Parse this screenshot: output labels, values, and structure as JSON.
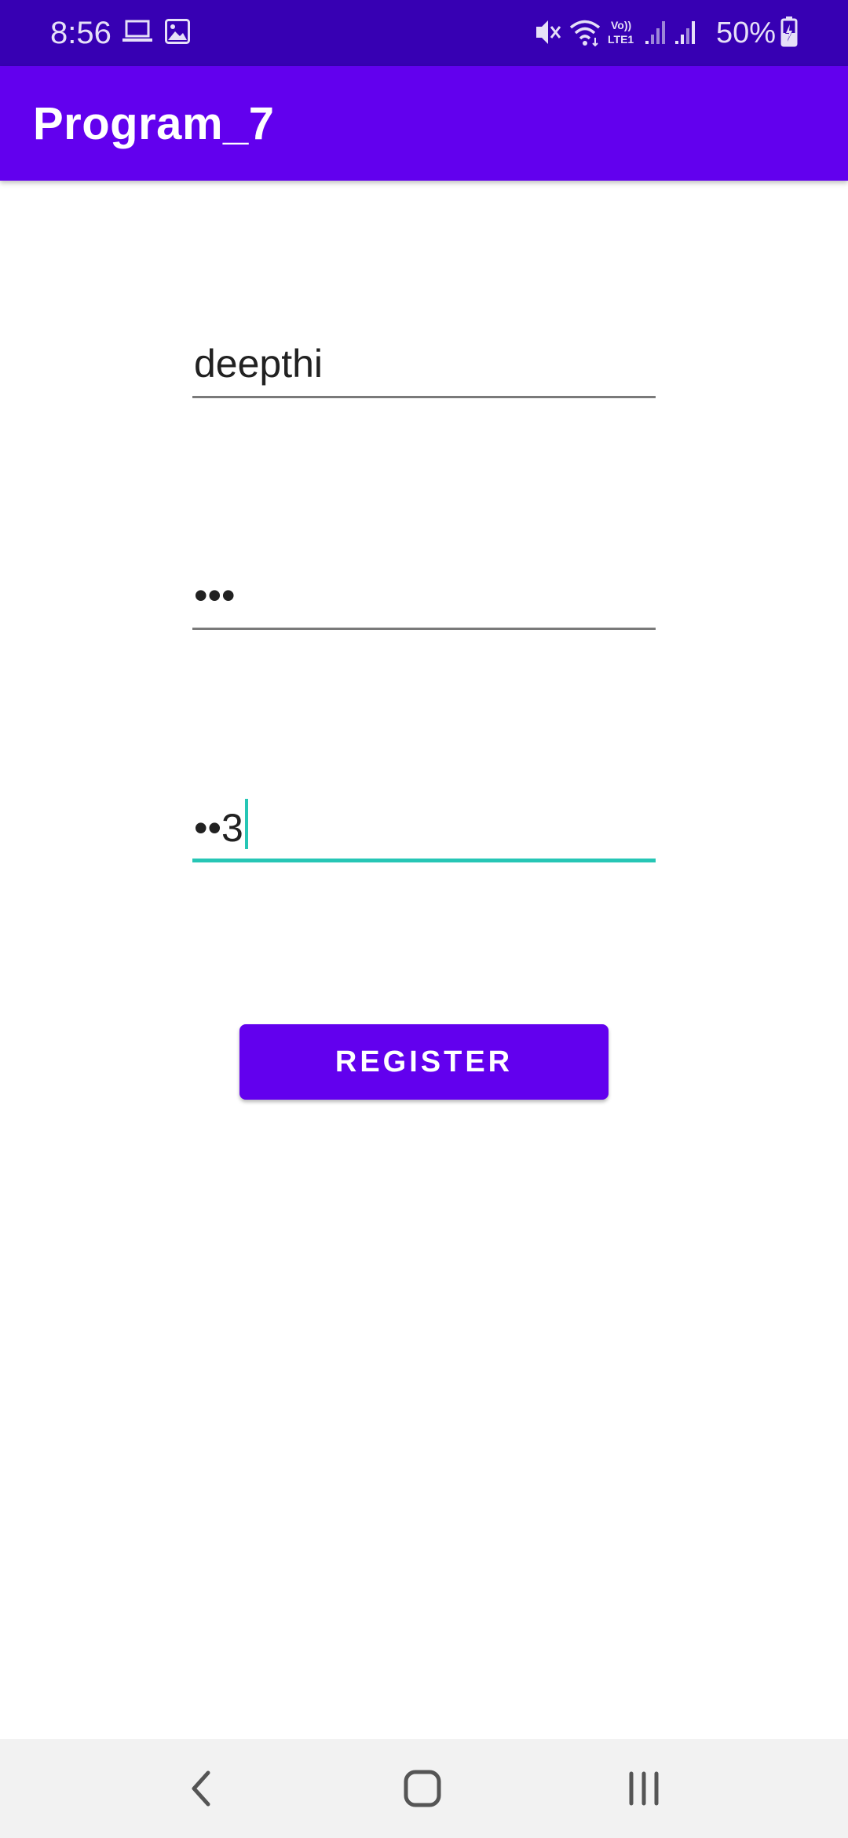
{
  "status_bar": {
    "time": "8:56",
    "battery_percent": "50%",
    "icons": [
      "laptop-icon",
      "image-icon",
      "mute-icon",
      "wifi-icon",
      "volte-icon",
      "signal-icon",
      "signal-icon",
      "battery-charging-icon"
    ],
    "volte_label": "Vo)) LTE1"
  },
  "app_bar": {
    "title": "Program_7"
  },
  "form": {
    "username_value": "deepthi",
    "password_value": "•••",
    "confirm_password_value": "••3",
    "register_label": "REGISTER"
  },
  "nav_bar": {
    "icons": [
      "back-icon",
      "home-icon",
      "recents-icon"
    ]
  },
  "colors": {
    "status_bar": "#3700b3",
    "primary": "#6200ee",
    "accent": "#26c6b5",
    "nav_bar": "#f2f2f2"
  }
}
